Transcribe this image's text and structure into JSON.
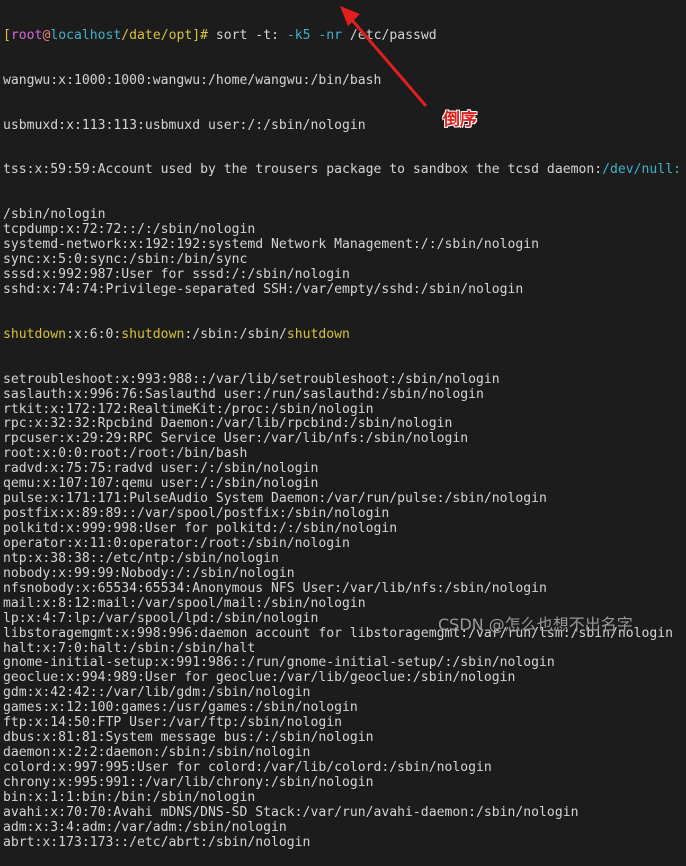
{
  "prompt": {
    "open": "[",
    "user": "root",
    "at": "@",
    "host": "localhost",
    "path": "/date/opt",
    "close": "]# ",
    "cmd1": "sort -t: ",
    "opt1": "-k5",
    "sp": " ",
    "opt2": "-nr",
    "cmd2": " /etc/passwd"
  },
  "tss_line": {
    "pre": "tss:x:59:59:Account used by the trousers package to sandbox the tcsd daemon:",
    "hl": "/dev/null:"
  },
  "lines_a": [
    "wangwu:x:1000:1000:wangwu:/home/wangwu:/bin/bash",
    "usbmuxd:x:113:113:usbmuxd user:/:/sbin/nologin"
  ],
  "lines_b": [
    "/sbin/nologin",
    "tcpdump:x:72:72::/:/sbin/nologin",
    "systemd-network:x:192:192:systemd Network Management:/:/sbin/nologin",
    "sync:x:5:0:sync:/sbin:/bin/sync",
    "sssd:x:992:987:User for sssd:/:/sbin/nologin",
    "sshd:x:74:74:Privilege-separated SSH:/var/empty/sshd:/sbin/nologin"
  ],
  "shutdown_line": {
    "a": "shutdown",
    "b": ":x:6:0:",
    "c": "shutdown",
    "d": ":/sbin:/sbin/",
    "e": "shutdown"
  },
  "lines_c": [
    "setroubleshoot:x:993:988::/var/lib/setroubleshoot:/sbin/nologin",
    "saslauth:x:996:76:Saslauthd user:/run/saslauthd:/sbin/nologin",
    "rtkit:x:172:172:RealtimeKit:/proc:/sbin/nologin",
    "rpc:x:32:32:Rpcbind Daemon:/var/lib/rpcbind:/sbin/nologin",
    "rpcuser:x:29:29:RPC Service User:/var/lib/nfs:/sbin/nologin",
    "root:x:0:0:root:/root:/bin/bash",
    "radvd:x:75:75:radvd user:/:/sbin/nologin",
    "qemu:x:107:107:qemu user:/:/sbin/nologin",
    "pulse:x:171:171:PulseAudio System Daemon:/var/run/pulse:/sbin/nologin",
    "postfix:x:89:89::/var/spool/postfix:/sbin/nologin",
    "polkitd:x:999:998:User for polkitd:/:/sbin/nologin",
    "operator:x:11:0:operator:/root:/sbin/nologin",
    "ntp:x:38:38::/etc/ntp:/sbin/nologin",
    "nobody:x:99:99:Nobody:/:/sbin/nologin",
    "nfsnobody:x:65534:65534:Anonymous NFS User:/var/lib/nfs:/sbin/nologin",
    "mail:x:8:12:mail:/var/spool/mail:/sbin/nologin",
    "lp:x:4:7:lp:/var/spool/lpd:/sbin/nologin",
    "libstoragemgmt:x:998:996:daemon account for libstoragemgmt:/var/run/lsm:/sbin/nologin",
    "halt:x:7:0:halt:/sbin:/sbin/halt",
    "gnome-initial-setup:x:991:986::/run/gnome-initial-setup/:/sbin/nologin",
    "geoclue:x:994:989:User for geoclue:/var/lib/geoclue:/sbin/nologin",
    "gdm:x:42:42::/var/lib/gdm:/sbin/nologin",
    "games:x:12:100:games:/usr/games:/sbin/nologin",
    "ftp:x:14:50:FTP User:/var/ftp:/sbin/nologin",
    "dbus:x:81:81:System message bus:/:/sbin/nologin",
    "daemon:x:2:2:daemon:/sbin:/sbin/nologin",
    "colord:x:997:995:User for colord:/var/lib/colord:/sbin/nologin",
    "chrony:x:995:991::/var/lib/chrony:/sbin/nologin",
    "bin:x:1:1:bin:/bin:/sbin/nologin",
    "avahi:x:70:70:Avahi mDNS/DNS-SD Stack:/var/run/avahi-daemon:/sbin/nologin",
    "adm:x:3:4:adm:/var/adm:/sbin/nologin",
    "abrt:x:173:173::/etc/abrt:/sbin/nologin"
  ],
  "annotation": "倒序",
  "watermark": "CSDN @怎么也想不出名字",
  "colors": {
    "background": "#1c1c1c",
    "text": "#d4d4d4",
    "arrow": "#e0201e",
    "highlight_cyan": "#3fb2c9",
    "highlight_yellow": "#d7c23a"
  }
}
